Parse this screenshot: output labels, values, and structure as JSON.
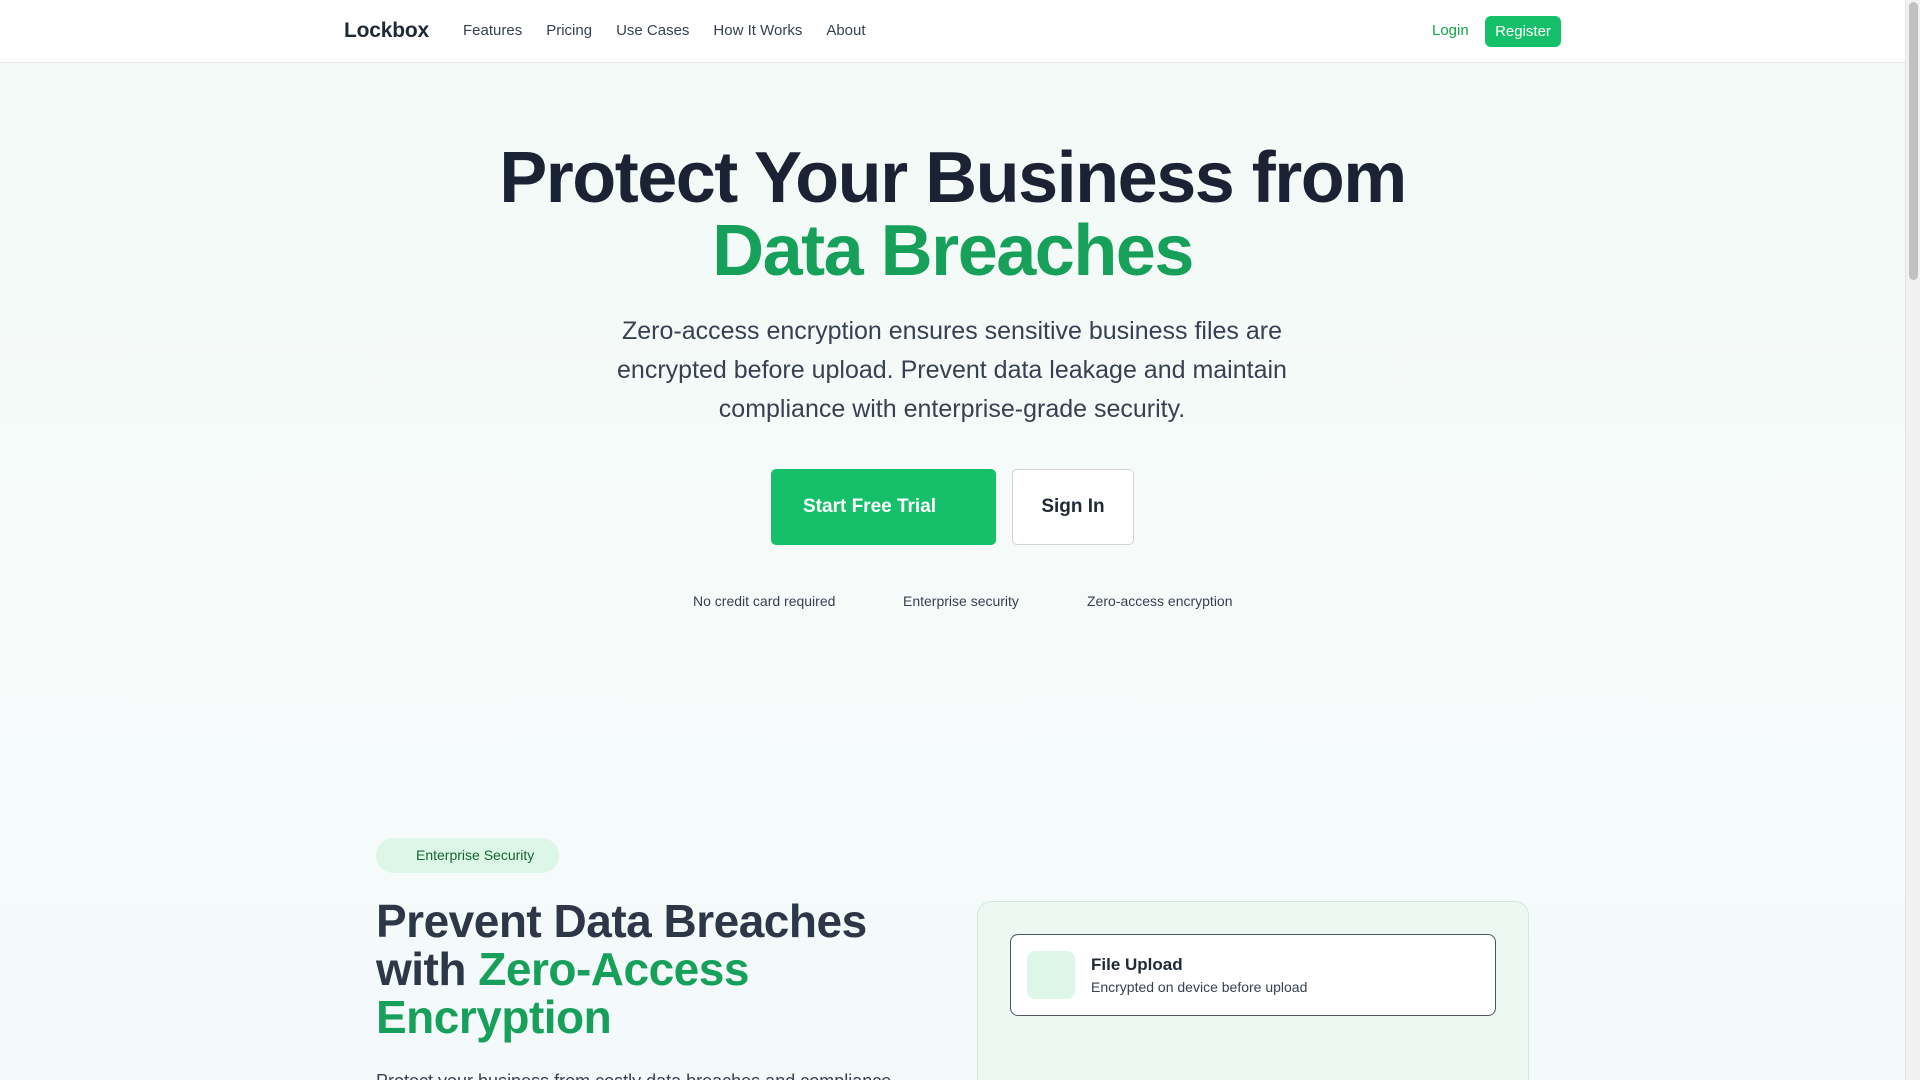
{
  "nav": {
    "logo": "Lockbox",
    "links": [
      "Features",
      "Pricing",
      "Use Cases",
      "How It Works",
      "About"
    ],
    "login": "Login",
    "register": "Register"
  },
  "hero": {
    "title_line1": "Protect Your Business from",
    "title_line2": "Data Breaches",
    "subtitle": "Zero-access encryption ensures sensitive business files are encrypted before upload. Prevent data leakage and maintain compliance with enterprise-grade security.",
    "cta_primary": "Start Free Trial",
    "cta_secondary": "Sign In",
    "trust": [
      "No credit card required",
      "Enterprise security",
      "Zero-access encryption"
    ]
  },
  "feature": {
    "pill": "Enterprise Security",
    "title_part1": "Prevent Data Breaches with ",
    "title_accent": "Zero-Access Encryption",
    "description": "Protect your business from costly data breaches and compliance",
    "card": {
      "title": "File Upload",
      "subtitle": "Encrypted on device before upload"
    }
  },
  "colors": {
    "accent": "#16c06a",
    "accent_text": "#16a05a",
    "pill_bg": "#dcf7e7"
  }
}
